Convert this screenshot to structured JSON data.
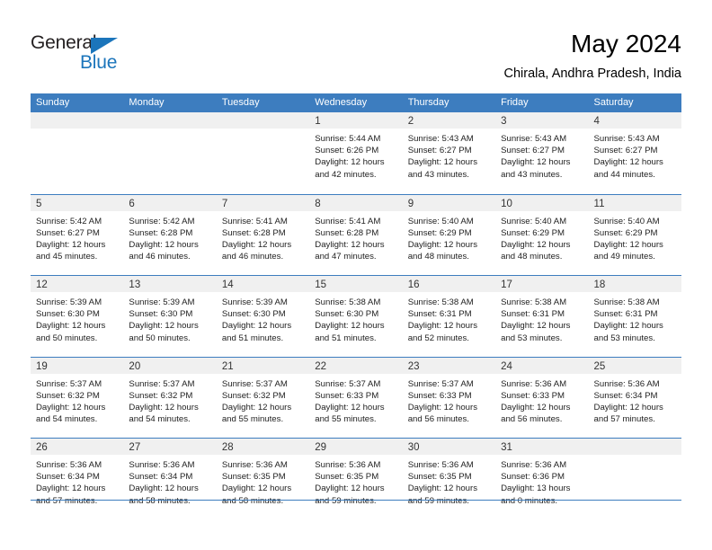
{
  "brand": {
    "name_part1": "General",
    "name_part2": "Blue",
    "triangle_color": "#1b75bb",
    "text_color": "#231f20"
  },
  "header": {
    "title": "May 2024",
    "subtitle": "Chirala, Andhra Pradesh, India"
  },
  "theme": {
    "header_row_bg": "#3d7dbf",
    "date_band_bg": "#f0f0f0",
    "rule_color": "#3d7dbf",
    "body_text": "#222222"
  },
  "calendar": {
    "weekday_headers": [
      "Sunday",
      "Monday",
      "Tuesday",
      "Wednesday",
      "Thursday",
      "Friday",
      "Saturday"
    ],
    "weeks": [
      [
        {
          "day": "",
          "lines": []
        },
        {
          "day": "",
          "lines": []
        },
        {
          "day": "",
          "lines": []
        },
        {
          "day": "1",
          "lines": [
            "Sunrise: 5:44 AM",
            "Sunset: 6:26 PM",
            "Daylight: 12 hours",
            "and 42 minutes."
          ]
        },
        {
          "day": "2",
          "lines": [
            "Sunrise: 5:43 AM",
            "Sunset: 6:27 PM",
            "Daylight: 12 hours",
            "and 43 minutes."
          ]
        },
        {
          "day": "3",
          "lines": [
            "Sunrise: 5:43 AM",
            "Sunset: 6:27 PM",
            "Daylight: 12 hours",
            "and 43 minutes."
          ]
        },
        {
          "day": "4",
          "lines": [
            "Sunrise: 5:43 AM",
            "Sunset: 6:27 PM",
            "Daylight: 12 hours",
            "and 44 minutes."
          ]
        }
      ],
      [
        {
          "day": "5",
          "lines": [
            "Sunrise: 5:42 AM",
            "Sunset: 6:27 PM",
            "Daylight: 12 hours",
            "and 45 minutes."
          ]
        },
        {
          "day": "6",
          "lines": [
            "Sunrise: 5:42 AM",
            "Sunset: 6:28 PM",
            "Daylight: 12 hours",
            "and 46 minutes."
          ]
        },
        {
          "day": "7",
          "lines": [
            "Sunrise: 5:41 AM",
            "Sunset: 6:28 PM",
            "Daylight: 12 hours",
            "and 46 minutes."
          ]
        },
        {
          "day": "8",
          "lines": [
            "Sunrise: 5:41 AM",
            "Sunset: 6:28 PM",
            "Daylight: 12 hours",
            "and 47 minutes."
          ]
        },
        {
          "day": "9",
          "lines": [
            "Sunrise: 5:40 AM",
            "Sunset: 6:29 PM",
            "Daylight: 12 hours",
            "and 48 minutes."
          ]
        },
        {
          "day": "10",
          "lines": [
            "Sunrise: 5:40 AM",
            "Sunset: 6:29 PM",
            "Daylight: 12 hours",
            "and 48 minutes."
          ]
        },
        {
          "day": "11",
          "lines": [
            "Sunrise: 5:40 AM",
            "Sunset: 6:29 PM",
            "Daylight: 12 hours",
            "and 49 minutes."
          ]
        }
      ],
      [
        {
          "day": "12",
          "lines": [
            "Sunrise: 5:39 AM",
            "Sunset: 6:30 PM",
            "Daylight: 12 hours",
            "and 50 minutes."
          ]
        },
        {
          "day": "13",
          "lines": [
            "Sunrise: 5:39 AM",
            "Sunset: 6:30 PM",
            "Daylight: 12 hours",
            "and 50 minutes."
          ]
        },
        {
          "day": "14",
          "lines": [
            "Sunrise: 5:39 AM",
            "Sunset: 6:30 PM",
            "Daylight: 12 hours",
            "and 51 minutes."
          ]
        },
        {
          "day": "15",
          "lines": [
            "Sunrise: 5:38 AM",
            "Sunset: 6:30 PM",
            "Daylight: 12 hours",
            "and 51 minutes."
          ]
        },
        {
          "day": "16",
          "lines": [
            "Sunrise: 5:38 AM",
            "Sunset: 6:31 PM",
            "Daylight: 12 hours",
            "and 52 minutes."
          ]
        },
        {
          "day": "17",
          "lines": [
            "Sunrise: 5:38 AM",
            "Sunset: 6:31 PM",
            "Daylight: 12 hours",
            "and 53 minutes."
          ]
        },
        {
          "day": "18",
          "lines": [
            "Sunrise: 5:38 AM",
            "Sunset: 6:31 PM",
            "Daylight: 12 hours",
            "and 53 minutes."
          ]
        }
      ],
      [
        {
          "day": "19",
          "lines": [
            "Sunrise: 5:37 AM",
            "Sunset: 6:32 PM",
            "Daylight: 12 hours",
            "and 54 minutes."
          ]
        },
        {
          "day": "20",
          "lines": [
            "Sunrise: 5:37 AM",
            "Sunset: 6:32 PM",
            "Daylight: 12 hours",
            "and 54 minutes."
          ]
        },
        {
          "day": "21",
          "lines": [
            "Sunrise: 5:37 AM",
            "Sunset: 6:32 PM",
            "Daylight: 12 hours",
            "and 55 minutes."
          ]
        },
        {
          "day": "22",
          "lines": [
            "Sunrise: 5:37 AM",
            "Sunset: 6:33 PM",
            "Daylight: 12 hours",
            "and 55 minutes."
          ]
        },
        {
          "day": "23",
          "lines": [
            "Sunrise: 5:37 AM",
            "Sunset: 6:33 PM",
            "Daylight: 12 hours",
            "and 56 minutes."
          ]
        },
        {
          "day": "24",
          "lines": [
            "Sunrise: 5:36 AM",
            "Sunset: 6:33 PM",
            "Daylight: 12 hours",
            "and 56 minutes."
          ]
        },
        {
          "day": "25",
          "lines": [
            "Sunrise: 5:36 AM",
            "Sunset: 6:34 PM",
            "Daylight: 12 hours",
            "and 57 minutes."
          ]
        }
      ],
      [
        {
          "day": "26",
          "lines": [
            "Sunrise: 5:36 AM",
            "Sunset: 6:34 PM",
            "Daylight: 12 hours",
            "and 57 minutes."
          ]
        },
        {
          "day": "27",
          "lines": [
            "Sunrise: 5:36 AM",
            "Sunset: 6:34 PM",
            "Daylight: 12 hours",
            "and 58 minutes."
          ]
        },
        {
          "day": "28",
          "lines": [
            "Sunrise: 5:36 AM",
            "Sunset: 6:35 PM",
            "Daylight: 12 hours",
            "and 58 minutes."
          ]
        },
        {
          "day": "29",
          "lines": [
            "Sunrise: 5:36 AM",
            "Sunset: 6:35 PM",
            "Daylight: 12 hours",
            "and 59 minutes."
          ]
        },
        {
          "day": "30",
          "lines": [
            "Sunrise: 5:36 AM",
            "Sunset: 6:35 PM",
            "Daylight: 12 hours",
            "and 59 minutes."
          ]
        },
        {
          "day": "31",
          "lines": [
            "Sunrise: 5:36 AM",
            "Sunset: 6:36 PM",
            "Daylight: 13 hours",
            "and 0 minutes."
          ]
        },
        {
          "day": "",
          "lines": []
        }
      ]
    ]
  }
}
